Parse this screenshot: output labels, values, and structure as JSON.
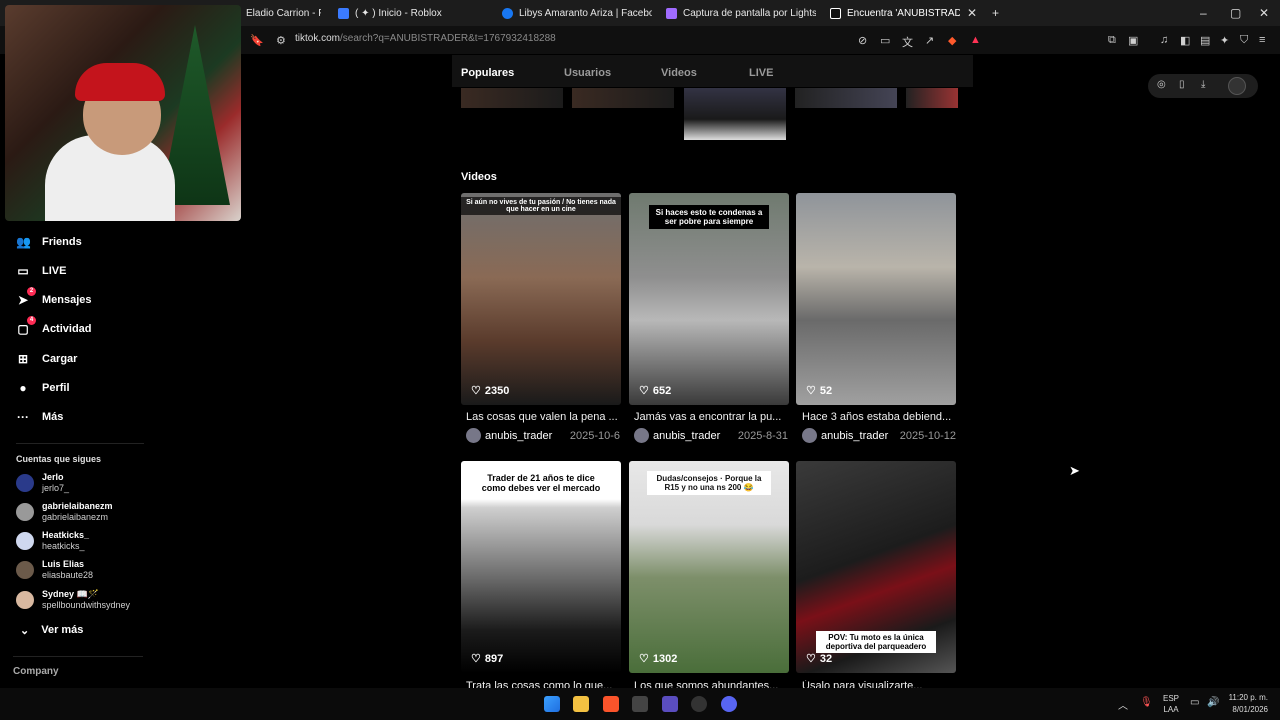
{
  "browser": {
    "tabs": [
      {
        "label": "Eladio Carrion - FUN",
        "color": "#ff4d4d"
      },
      {
        "label": "( ✦ ) Inicio - Roblox",
        "color": "#3b7bff"
      },
      {
        "label": "Libys Amaranto Ariza | Facebook",
        "color": "#1877f2"
      },
      {
        "label": "Captura de pantalla por Lightshot",
        "color": "#a06bff"
      },
      {
        "label": "Encuentra 'ANUBISTRADER' en T",
        "color": "#ffffff"
      }
    ],
    "url_host": "tiktok.com",
    "url_rest": "/search?q=ANUBISTRADER&t=1767932418288"
  },
  "sidebar": {
    "nav": [
      {
        "label": "Friends",
        "icon": "friends-icon",
        "badge": ""
      },
      {
        "label": "LIVE",
        "icon": "live-icon",
        "badge": ""
      },
      {
        "label": "Mensajes",
        "icon": "messages-icon",
        "badge": "2"
      },
      {
        "label": "Actividad",
        "icon": "activity-icon",
        "badge": "4"
      },
      {
        "label": "Cargar",
        "icon": "upload-icon",
        "badge": ""
      },
      {
        "label": "Perfil",
        "icon": "profile-icon",
        "badge": ""
      },
      {
        "label": "Más",
        "icon": "more-icon",
        "badge": ""
      }
    ],
    "following_title": "Cuentas que sigues",
    "following": [
      {
        "name": "Jerlo",
        "handle": "jerlo7_"
      },
      {
        "name": "gabrielaibanezm",
        "handle": "gabrielaibanezm"
      },
      {
        "name": "Heatkicks_",
        "handle": "heatkicks_"
      },
      {
        "name": "Luis Elias",
        "handle": "eliasbaute28"
      },
      {
        "name": "Sydney 📖🪄",
        "handle": "spellboundwithsydney"
      }
    ],
    "see_more": "Ver más",
    "company": "Company"
  },
  "search": {
    "tabs": [
      "Populares",
      "Usuarios",
      "Videos",
      "LIVE"
    ],
    "active_tab": "Populares",
    "videos_heading": "Videos"
  },
  "videos": [
    {
      "caption_overlay": "Si aún no vives de tu pasión / No tienes nada que hacer en un cine",
      "likes": "2350",
      "title": "Las cosas que valen la pena ...",
      "author": "anubis_trader",
      "date": "2025-10-6"
    },
    {
      "caption_overlay": "Si haces esto te condenas a ser pobre para siempre",
      "likes": "652",
      "title": "Jamás vas a encontrar la pu...",
      "author": "anubis_trader",
      "date": "2025-8-31"
    },
    {
      "caption_overlay": "",
      "likes": "52",
      "title": "Hace 3 años estaba debiend...",
      "author": "anubis_trader",
      "date": "2025-10-12"
    },
    {
      "caption_overlay": "Trader de 21 años te dice como debes ver el mercado",
      "likes": "897",
      "title": "Trata las cosas como lo que...",
      "author": "",
      "date": ""
    },
    {
      "caption_overlay": "Dudas/consejos · Porque la R15 y no una ns 200 😂",
      "likes": "1302",
      "title": "Los que somos abundantes...",
      "author": "",
      "date": ""
    },
    {
      "caption_overlay": "POV: Tu moto es la única deportiva del parqueadero",
      "likes": "32",
      "title": "Úsalo para visualizarte...",
      "author": "",
      "date": ""
    }
  ],
  "taskbar": {
    "lang_top": "ESP",
    "lang_bottom": "LAA",
    "time": "11:20 p. m.",
    "date": "8/01/2026"
  }
}
